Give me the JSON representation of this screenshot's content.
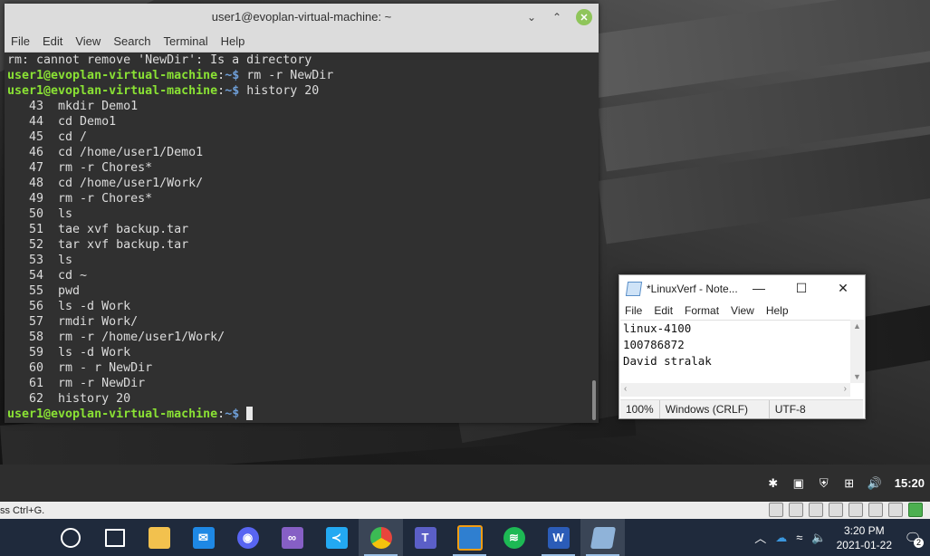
{
  "terminal": {
    "title": "user1@evoplan-virtual-machine: ~",
    "menu": [
      "File",
      "Edit",
      "View",
      "Search",
      "Terminal",
      "Help"
    ],
    "prompt_user": "user1@evoplan-virtual-machine",
    "prompt_sep": ":",
    "prompt_path": "~$",
    "lines": [
      {
        "kind": "out",
        "text": "rm: cannot remove 'NewDir': Is a directory"
      },
      {
        "kind": "prompt",
        "cmd": " rm -r NewDir"
      },
      {
        "kind": "prompt",
        "cmd": " history 20"
      },
      {
        "kind": "out",
        "text": "   43  mkdir Demo1"
      },
      {
        "kind": "out",
        "text": "   44  cd Demo1"
      },
      {
        "kind": "out",
        "text": "   45  cd /"
      },
      {
        "kind": "out",
        "text": "   46  cd /home/user1/Demo1"
      },
      {
        "kind": "out",
        "text": "   47  rm -r Chores*"
      },
      {
        "kind": "out",
        "text": "   48  cd /home/user1/Work/"
      },
      {
        "kind": "out",
        "text": "   49  rm -r Chores*"
      },
      {
        "kind": "out",
        "text": "   50  ls"
      },
      {
        "kind": "out",
        "text": "   51  tae xvf backup.tar"
      },
      {
        "kind": "out",
        "text": "   52  tar xvf backup.tar"
      },
      {
        "kind": "out",
        "text": "   53  ls"
      },
      {
        "kind": "out",
        "text": "   54  cd ~"
      },
      {
        "kind": "out",
        "text": "   55  pwd"
      },
      {
        "kind": "out",
        "text": "   56  ls -d Work"
      },
      {
        "kind": "out",
        "text": "   57  rmdir Work/"
      },
      {
        "kind": "out",
        "text": "   58  rm -r /home/user1/Work/"
      },
      {
        "kind": "out",
        "text": "   59  ls -d Work"
      },
      {
        "kind": "out",
        "text": "   60  rm - r NewDir"
      },
      {
        "kind": "out",
        "text": "   61  rm -r NewDir"
      },
      {
        "kind": "out",
        "text": "   62  history 20"
      },
      {
        "kind": "prompt",
        "cmd": " "
      }
    ]
  },
  "notepad": {
    "title": "*LinuxVerf - Note...",
    "menu": [
      "File",
      "Edit",
      "Format",
      "View",
      "Help"
    ],
    "content": [
      "linux-4100",
      "100786872",
      "David stralak"
    ],
    "status": {
      "zoom": "100%",
      "line_ending": "Windows (CRLF)",
      "encoding": "UTF-8"
    }
  },
  "mint_panel": {
    "tray_icons": [
      "bluetooth-icon",
      "clipboard-icon",
      "shield-icon",
      "network-icon",
      "volume-icon"
    ],
    "clock": "15:20"
  },
  "vm_status": {
    "hint": "ss Ctrl+G."
  },
  "win_taskbar": {
    "apps": [
      {
        "name": "cortana-search",
        "color": "#1f2a3c"
      },
      {
        "name": "task-view",
        "color": "#1f2a3c"
      },
      {
        "name": "file-explorer",
        "color": "#f2c14e"
      },
      {
        "name": "mail",
        "color": "#1e88e5"
      },
      {
        "name": "discord",
        "color": "#5865f2"
      },
      {
        "name": "visual-studio",
        "color": "#865fc5"
      },
      {
        "name": "vscode",
        "color": "#23a9f2"
      },
      {
        "name": "chrome",
        "color": "#e8453c"
      },
      {
        "name": "teams",
        "color": "#5b5fc7"
      },
      {
        "name": "virtualbox",
        "color": "#2f7fd0"
      },
      {
        "name": "spotify",
        "color": "#1db954"
      },
      {
        "name": "word",
        "color": "#2b5cb8"
      },
      {
        "name": "notepad",
        "color": "#8fb3d9"
      }
    ],
    "time": "3:20 PM",
    "date": "2021-01-22",
    "notification_count": "2"
  }
}
